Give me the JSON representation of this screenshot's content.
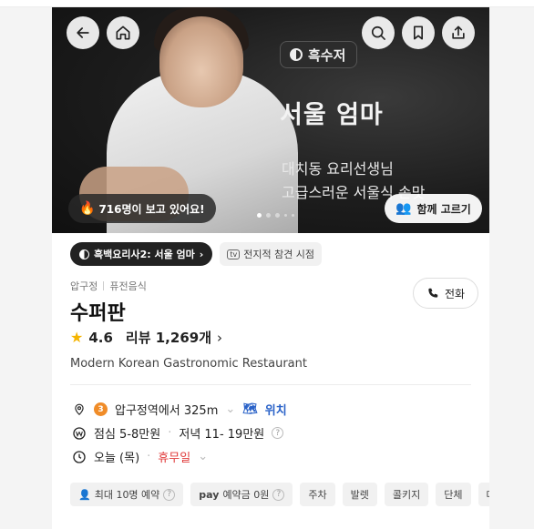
{
  "hero": {
    "show_badge": "흑수저",
    "name": "서울 엄마",
    "subtitle_line1": "대치동 요리선생님",
    "subtitle_line2": "고급스러운 서울식 손맛",
    "viewers": "716명이 보고 있어요!",
    "together_button": "함께 고르기",
    "carousel": {
      "total": 5,
      "active": 1
    }
  },
  "tags": {
    "show_chip": "흑백요리사2: 서울 엄마",
    "tv_badge": "tv",
    "tv_chip": "전지적 참견 시점"
  },
  "restaurant": {
    "area": "압구정",
    "category": "퓨전음식",
    "name": "수퍼판",
    "call_button": "전화",
    "rating": "4.6",
    "reviews": "리뷰 1,269개",
    "description": "Modern Korean Gastronomic Restaurant"
  },
  "info": {
    "subway_line": "3",
    "location": "압구정역에서 325m",
    "map_link": "위치",
    "lunch_price": "점심 5-8만원",
    "dinner_price": "저녁 11- 19만원",
    "today": "오늘 (목)",
    "today_status": "휴무일"
  },
  "features": [
    {
      "label": "최대 10명 예약",
      "icon": "person-icon",
      "help": true
    },
    {
      "label": "예약금 0원",
      "icon": "pay-icon",
      "prefix": "pay",
      "help": true
    },
    {
      "label": "주차"
    },
    {
      "label": "발렛"
    },
    {
      "label": "콜키지"
    },
    {
      "label": "단체"
    },
    {
      "label": "대"
    }
  ],
  "colors": {
    "accent_orange": "#f08c28",
    "link_blue": "#2a62c8",
    "closed_red": "#e03a3a",
    "star": "#f5b400"
  }
}
